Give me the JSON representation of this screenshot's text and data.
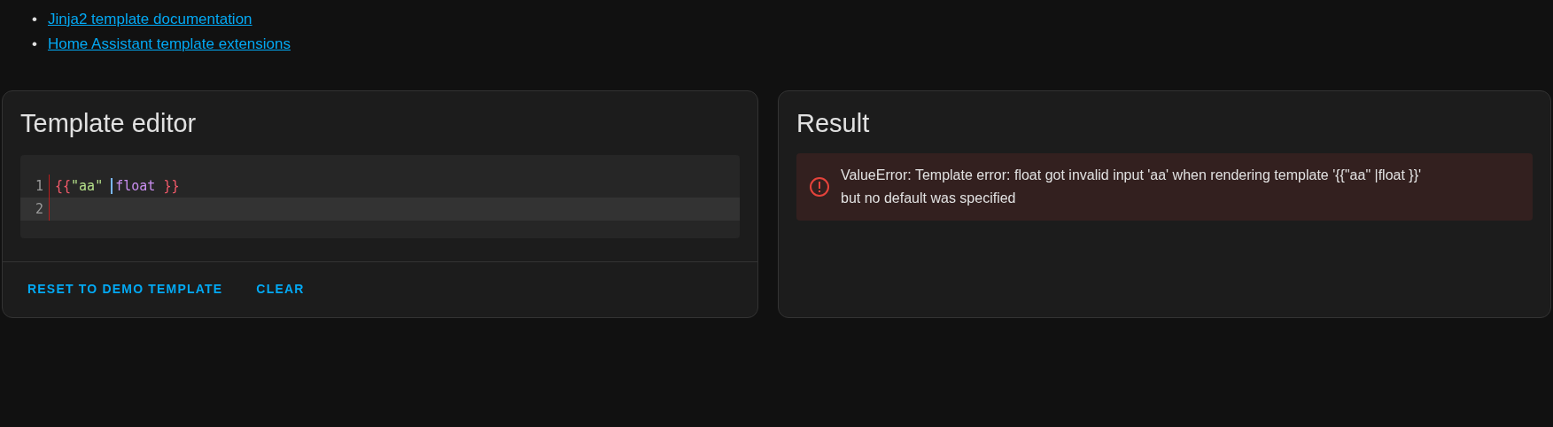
{
  "links": [
    {
      "bullet": "•",
      "label": "Jinja2 template documentation"
    },
    {
      "bullet": "•",
      "label": "Home Assistant template extensions"
    }
  ],
  "editor_card": {
    "title": "Template editor",
    "lines": [
      {
        "number": "1",
        "active": false,
        "tokens": [
          {
            "kind": "brace",
            "text": "{{"
          },
          {
            "kind": "string",
            "text": "\"aa\" "
          },
          {
            "kind": "cursor"
          },
          {
            "kind": "filter",
            "text": "float "
          },
          {
            "kind": "brace",
            "text": "}}"
          }
        ]
      },
      {
        "number": "2",
        "active": true
      }
    ],
    "buttons": [
      {
        "label": "RESET TO DEMO TEMPLATE"
      },
      {
        "label": "CLEAR"
      }
    ]
  },
  "result_card": {
    "title": "Result",
    "error": {
      "message": "ValueError: Template error: float got invalid input 'aa' when rendering template '{{\"aa\" |float }}' but no default was specified"
    }
  }
}
